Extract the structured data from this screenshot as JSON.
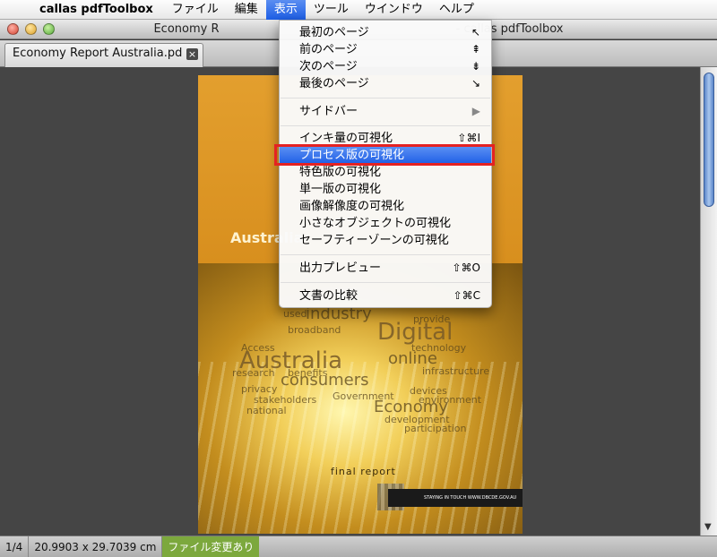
{
  "menubar": {
    "apple_icon": "apple-icon",
    "app_name": "callas pdfToolbox",
    "items": [
      "ファイル",
      "編集",
      "表示",
      "ツール",
      "ウインドウ",
      "ヘルプ"
    ]
  },
  "window": {
    "title_left": "Economy R",
    "title_right": "- callas pdfToolbox"
  },
  "tab": {
    "label": "Economy Report Australia.pd",
    "close": "×"
  },
  "menu": {
    "items": [
      {
        "label": "最初のページ",
        "shortcut": "↖"
      },
      {
        "label": "前のページ",
        "shortcut": "⇞"
      },
      {
        "label": "次のページ",
        "shortcut": "⇟"
      },
      {
        "label": "最後のページ",
        "shortcut": "↘"
      },
      {
        "label": "サイドバー",
        "shortcut": "▶"
      },
      {
        "label": "インキ量の可視化",
        "shortcut": "⇧⌘I"
      },
      {
        "label": "プロセス版の可視化",
        "shortcut": ""
      },
      {
        "label": "特色版の可視化",
        "shortcut": ""
      },
      {
        "label": "単一版の可視化",
        "shortcut": ""
      },
      {
        "label": "画像解像度の可視化",
        "shortcut": ""
      },
      {
        "label": "小さなオブジェクトの可視化",
        "shortcut": ""
      },
      {
        "label": "セーフティーゾーンの可視化",
        "shortcut": ""
      },
      {
        "label": "出力プレビュー",
        "shortcut": "⇧⌘O"
      },
      {
        "label": "文書の比較",
        "shortcut": "⇧⌘C"
      }
    ]
  },
  "document": {
    "title": "Australia",
    "final_report": "final report",
    "footer": "STAYING IN TOUCH  WWW.DBCDE.GOV.AU",
    "words": {
      "industry": "industry",
      "digital": "Digital",
      "australia": "Australia",
      "online": "online",
      "consumers": "consumers",
      "broadband": "broadband",
      "access": "Access",
      "government": "Government",
      "economy": "Economy",
      "technology": "technology",
      "national": "national",
      "stakeholders": "stakeholders",
      "participation": "participation",
      "privacy": "privacy",
      "devices": "devices",
      "infrastructure": "infrastructure",
      "research": "research",
      "benefits": "benefits",
      "development": "development",
      "environment": "environment",
      "used": "used",
      "provide": "provide"
    }
  },
  "status": {
    "page": "1/4",
    "size": "20.9903 x 29.7039 cm",
    "modified": "ファイル変更あり"
  }
}
